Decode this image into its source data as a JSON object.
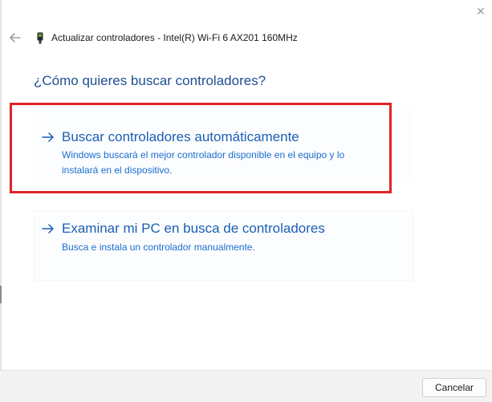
{
  "window": {
    "title": "Actualizar controladores - Intel(R) Wi-Fi 6 AX201 160MHz",
    "close_icon": "close-icon",
    "back_icon": "back-arrow-icon",
    "device_icon": "network-adapter-icon"
  },
  "main": {
    "question": "¿Cómo quieres buscar controladores?",
    "options": [
      {
        "title": "Buscar controladores automáticamente",
        "description_line1": "Windows buscará el mejor controlador disponible en el equipo y lo",
        "description_line2": "instalará en el dispositivo.",
        "icon": "arrow-right-icon"
      },
      {
        "title": "Examinar mi PC en busca de controladores",
        "description_line1": "Busca e instala un controlador manualmente.",
        "icon": "arrow-right-icon"
      }
    ]
  },
  "footer": {
    "cancel_label": "Cancelar"
  },
  "colors": {
    "accent": "#1a5fb4",
    "heading": "#1f4e93",
    "highlight": "#e0222a",
    "footer_bg": "#f3f3f3"
  }
}
